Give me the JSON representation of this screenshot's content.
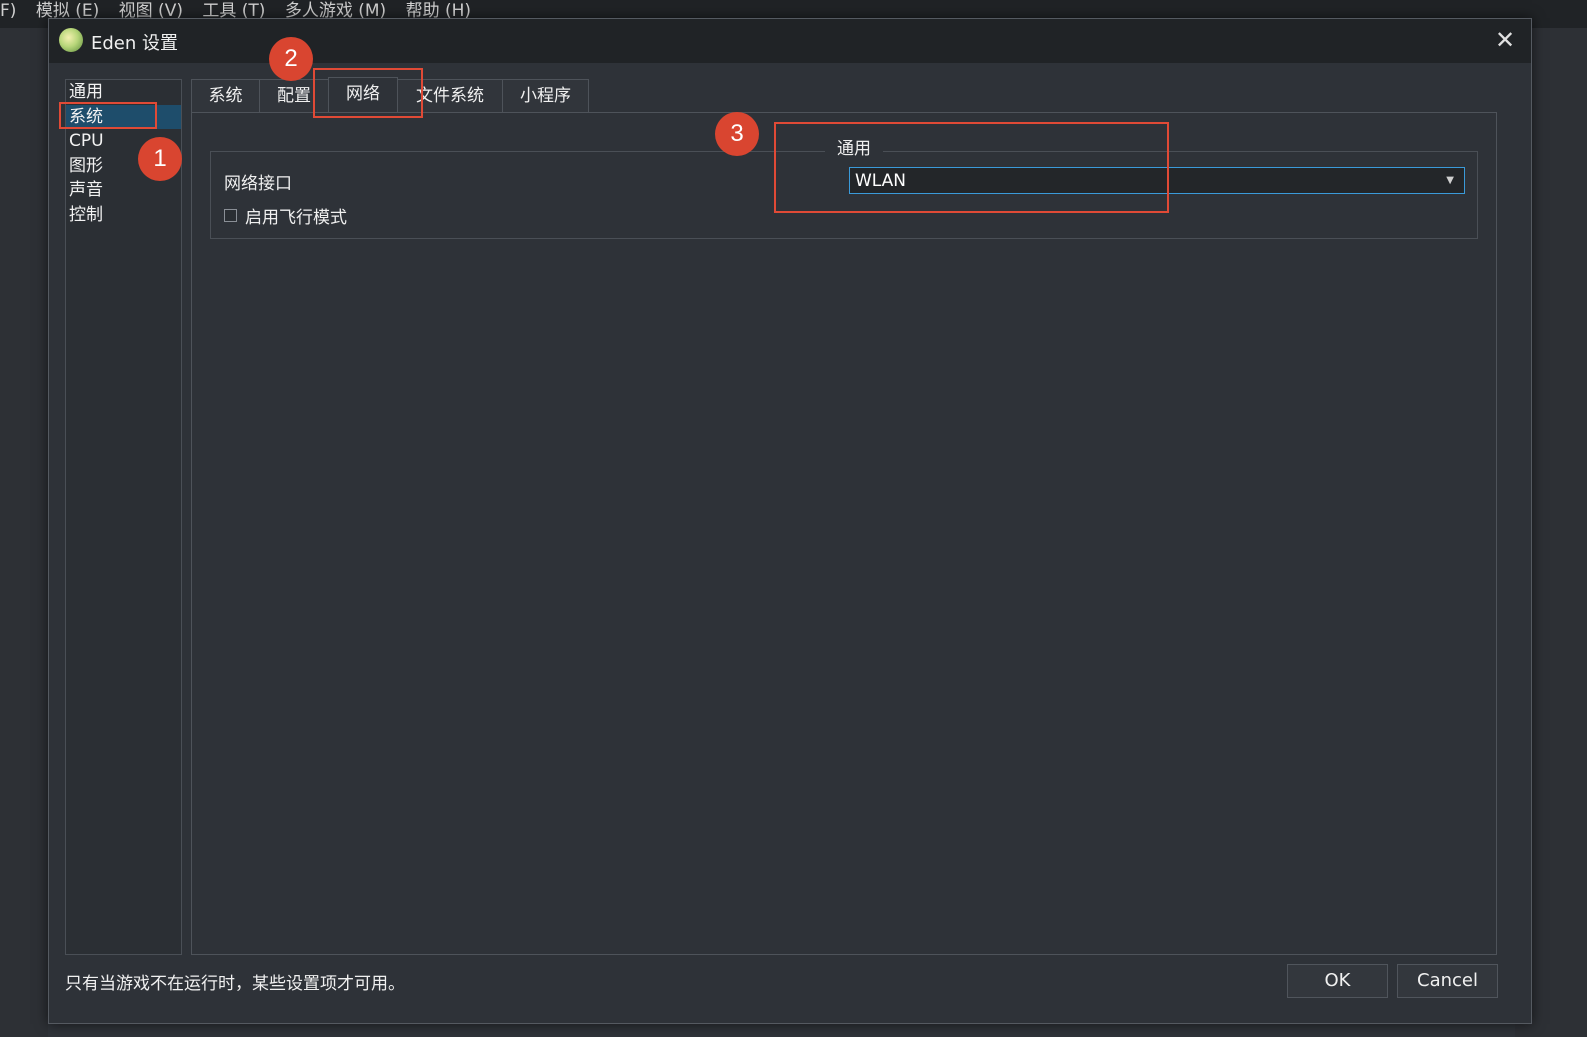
{
  "background_menu": {
    "items": [
      "F)",
      "模拟 (E)",
      "视图 (V)",
      "工具 (T)",
      "多人游戏 (M)",
      "帮助 (H)"
    ]
  },
  "window": {
    "title": "Eden 设置",
    "close_glyph": "✕"
  },
  "sidebar": {
    "items": [
      {
        "label": "通用"
      },
      {
        "label": "系统"
      },
      {
        "label": "CPU"
      },
      {
        "label": "图形"
      },
      {
        "label": "声音"
      },
      {
        "label": "控制"
      }
    ],
    "selected": "系统"
  },
  "tabs": [
    {
      "label": "系统"
    },
    {
      "label": "配置"
    },
    {
      "label": "网络"
    },
    {
      "label": "文件系统"
    },
    {
      "label": "小程序"
    }
  ],
  "active_tab": "网络",
  "network_group": {
    "title": "通用",
    "interface_label": "网络接口",
    "interface_value": "WLAN",
    "airplane_mode_label": "启用飞行模式",
    "airplane_mode_checked": false
  },
  "footer": {
    "note": "只有当游戏不在运行时，某些设置项才可用。",
    "ok_label": "OK",
    "cancel_label": "Cancel"
  },
  "annotations": {
    "badge1": "1",
    "badge2": "2",
    "badge3": "3"
  },
  "colors": {
    "annotation_red": "#d94530",
    "selection_blue": "#1e4d6b",
    "combo_focus": "#3a9ad9"
  }
}
